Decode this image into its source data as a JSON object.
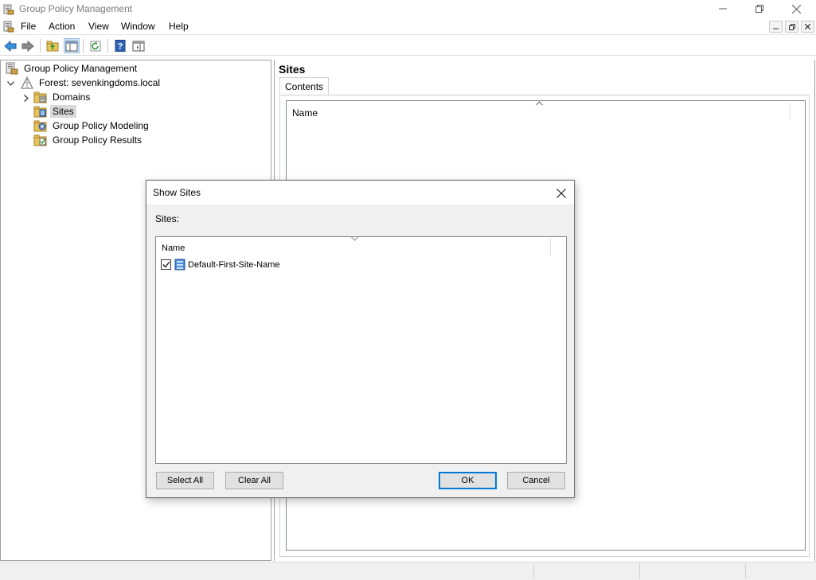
{
  "window": {
    "title": "Group Policy Management",
    "controls": [
      "minimize-icon",
      "restore-icon",
      "close-icon"
    ]
  },
  "menu": {
    "items": [
      "File",
      "Action",
      "View",
      "Window",
      "Help"
    ],
    "mdi_controls": [
      "minimize-icon",
      "restore-icon",
      "close-icon"
    ]
  },
  "toolbar": {
    "buttons": [
      "back-arrow-icon",
      "forward-arrow-icon",
      "up-folder-icon",
      "show-hide-tree-icon",
      "refresh-icon",
      "help-icon",
      "action-pane-icon"
    ]
  },
  "tree": {
    "root": "Group Policy Management",
    "forest": "Forest: sevenkingdoms.local",
    "children": [
      {
        "label": "Domains",
        "icon": "domains-folder-icon"
      },
      {
        "label": "Sites",
        "icon": "sites-folder-icon",
        "selected": true
      },
      {
        "label": "Group Policy Modeling",
        "icon": "modeling-icon"
      },
      {
        "label": "Group Policy Results",
        "icon": "results-icon"
      }
    ]
  },
  "right_pane": {
    "heading": "Sites",
    "tab": "Contents",
    "column": "Name"
  },
  "dialog": {
    "title": "Show Sites",
    "sites_label": "Sites:",
    "column": "Name",
    "items": [
      {
        "label": "Default-First-Site-Name",
        "checked": true
      }
    ],
    "buttons": {
      "select_all": "Select All",
      "clear_all": "Clear All",
      "ok": "OK",
      "cancel": "Cancel"
    }
  },
  "colors": {
    "accent": "#0078d7",
    "selection": "#d9d9d9",
    "dialog_bg": "#f0f0f0"
  }
}
